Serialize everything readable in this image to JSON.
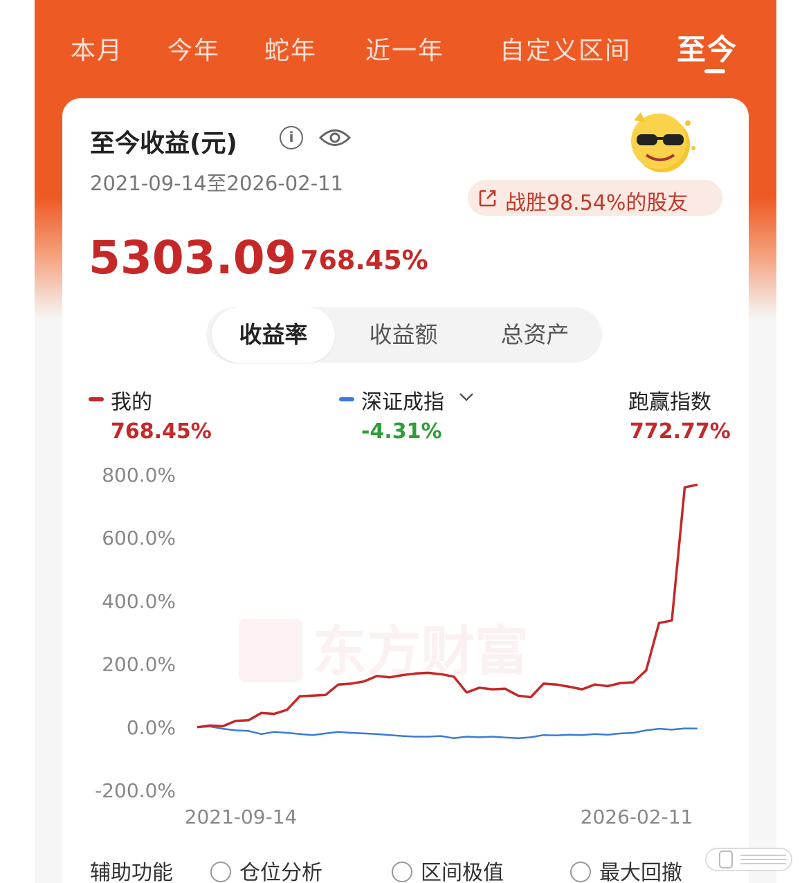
{
  "tabs": [
    {
      "label": "本月",
      "active": false
    },
    {
      "label": "今年",
      "active": false
    },
    {
      "label": "蛇年",
      "active": false
    },
    {
      "label": "近一年",
      "active": false
    },
    {
      "label": "自定义区间",
      "active": false
    },
    {
      "label": "至今",
      "active": true
    }
  ],
  "header": {
    "title": "至今收益(元)",
    "date_range": "2021-09-14至2026-02-11",
    "beat_text": "战胜98.54%的股友"
  },
  "summary": {
    "amount": "5303.09",
    "percent": "768.45%"
  },
  "segments": [
    {
      "label": "收益率",
      "active": true
    },
    {
      "label": "收益额",
      "active": false
    },
    {
      "label": "总资产",
      "active": false
    }
  ],
  "legend": {
    "mine": {
      "name": "我的",
      "value": "768.45%",
      "color": "#c62828"
    },
    "index": {
      "name": "深证成指",
      "value": "-4.31%",
      "color": "#3a7bd5",
      "value_color": "#2e9e3a"
    },
    "outperform": {
      "name": "跑赢指数",
      "value": "772.77%",
      "color": "#c62828"
    }
  },
  "watermark": "东方财富",
  "auxiliary": {
    "label": "辅助功能",
    "options": [
      "仓位分析",
      "区间极值",
      "最大回撤"
    ]
  },
  "chart_data": {
    "type": "line",
    "ylim": [
      -200,
      800
    ],
    "yticks": [
      "800.0%",
      "600.0%",
      "400.0%",
      "200.0%",
      "0.0%",
      "-200.0%"
    ],
    "ytick_values": [
      800,
      600,
      400,
      200,
      0,
      -200
    ],
    "xlabels": [
      "2021-09-14",
      "2026-02-11"
    ],
    "series": [
      {
        "name": "我的",
        "color": "#c62828",
        "values": [
          0,
          5,
          3,
          20,
          22,
          45,
          42,
          55,
          98,
          100,
          102,
          135,
          138,
          145,
          162,
          158,
          165,
          170,
          172,
          168,
          160,
          110,
          125,
          120,
          122,
          100,
          95,
          138,
          135,
          128,
          120,
          135,
          130,
          140,
          142,
          180,
          330,
          338,
          760,
          768.45
        ]
      },
      {
        "name": "深证成指",
        "color": "#3a7bd5",
        "values": [
          0,
          2,
          -5,
          -10,
          -12,
          -22,
          -15,
          -18,
          -22,
          -25,
          -20,
          -15,
          -18,
          -20,
          -22,
          -25,
          -28,
          -30,
          -30,
          -28,
          -35,
          -30,
          -32,
          -30,
          -33,
          -35,
          -32,
          -25,
          -26,
          -24,
          -25,
          -22,
          -24,
          -20,
          -18,
          -10,
          -5,
          -8,
          -4,
          -4.31
        ]
      }
    ]
  }
}
